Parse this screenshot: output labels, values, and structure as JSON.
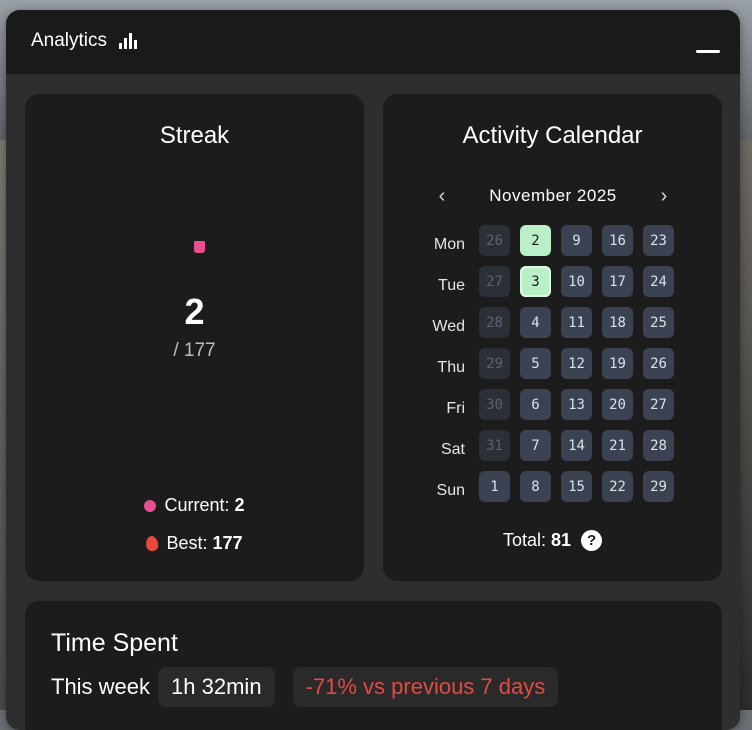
{
  "header": {
    "title": "Analytics",
    "icon": "bar-chart-icon"
  },
  "streak": {
    "title": "Streak",
    "value": "2",
    "total": "/ 177",
    "current_label": "Current:",
    "current_value": "2",
    "best_label": "Best:",
    "best_value": "177",
    "colors": {
      "accent": "#ea4e8f",
      "fire": "#e8493a"
    }
  },
  "calendar": {
    "title": "Activity Calendar",
    "month": "November 2025",
    "prev_symbol": "‹",
    "next_symbol": "›",
    "days": [
      "Mon",
      "Tue",
      "Wed",
      "Thu",
      "Fri",
      "Sat",
      "Sun"
    ],
    "weeks": [
      [
        {
          "d": "26",
          "state": "faded"
        },
        {
          "d": "27",
          "state": "faded"
        },
        {
          "d": "28",
          "state": "faded"
        },
        {
          "d": "29",
          "state": "faded"
        },
        {
          "d": "30",
          "state": "faded"
        },
        {
          "d": "31",
          "state": "faded"
        },
        {
          "d": "1",
          "state": "normal"
        }
      ],
      [
        {
          "d": "2",
          "state": "active"
        },
        {
          "d": "3",
          "state": "today"
        },
        {
          "d": "4",
          "state": "normal"
        },
        {
          "d": "5",
          "state": "normal"
        },
        {
          "d": "6",
          "state": "normal"
        },
        {
          "d": "7",
          "state": "normal"
        },
        {
          "d": "8",
          "state": "normal"
        }
      ],
      [
        {
          "d": "9",
          "state": "normal"
        },
        {
          "d": "10",
          "state": "normal"
        },
        {
          "d": "11",
          "state": "normal"
        },
        {
          "d": "12",
          "state": "normal"
        },
        {
          "d": "13",
          "state": "normal"
        },
        {
          "d": "14",
          "state": "normal"
        },
        {
          "d": "15",
          "state": "normal"
        }
      ],
      [
        {
          "d": "16",
          "state": "normal"
        },
        {
          "d": "17",
          "state": "normal"
        },
        {
          "d": "18",
          "state": "normal"
        },
        {
          "d": "19",
          "state": "normal"
        },
        {
          "d": "20",
          "state": "normal"
        },
        {
          "d": "21",
          "state": "normal"
        },
        {
          "d": "22",
          "state": "normal"
        }
      ],
      [
        {
          "d": "23",
          "state": "normal"
        },
        {
          "d": "24",
          "state": "normal"
        },
        {
          "d": "25",
          "state": "normal"
        },
        {
          "d": "26",
          "state": "normal"
        },
        {
          "d": "27",
          "state": "normal"
        },
        {
          "d": "28",
          "state": "normal"
        },
        {
          "d": "29",
          "state": "normal"
        }
      ]
    ],
    "total_label": "Total:",
    "total_value": "81",
    "help_symbol": "?",
    "colors": {
      "cell": "#3b4352",
      "active": "#b9f0c8"
    }
  },
  "time_spent": {
    "title": "Time Spent",
    "period_label": "This week",
    "duration": "1h 32min",
    "comparison": "-71% vs previous 7 days",
    "colors": {
      "negative": "#e34a43"
    }
  }
}
